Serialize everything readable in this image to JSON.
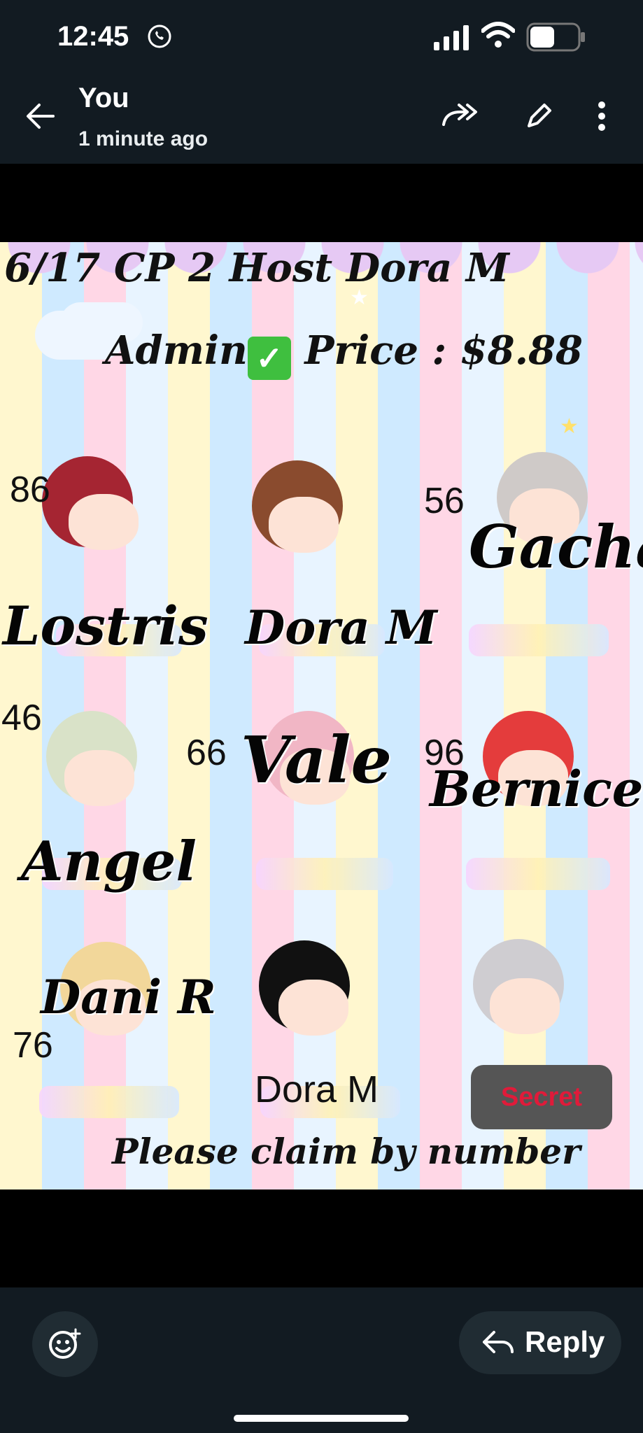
{
  "status_bar": {
    "time": "12:45"
  },
  "app_bar": {
    "title": "You",
    "subtitle": "1 minute ago"
  },
  "image": {
    "header_line": "6/17 CP 2 Host Dora M",
    "admin_label": "Admin",
    "price_label": "Price : $8.88",
    "items": [
      {
        "number": "86",
        "name": "Lostris"
      },
      {
        "number": "",
        "name": "Dora M"
      },
      {
        "number": "56",
        "name": "Gacha"
      },
      {
        "number": "46",
        "name": "Angel"
      },
      {
        "number": "66",
        "name": "Vale"
      },
      {
        "number": "96",
        "name": "Bernice"
      },
      {
        "number": "76",
        "name": "Dani R"
      },
      {
        "number": "",
        "name": "Dora M"
      },
      {
        "number": "",
        "name": "Secret"
      }
    ],
    "footer": "Please claim by number"
  },
  "actions": {
    "reply_label": "Reply"
  },
  "icons": [
    "whatsapp-icon",
    "signal-icon",
    "wifi-icon",
    "battery-icon",
    "back-arrow-icon",
    "forward-icon",
    "edit-pencil-icon",
    "more-vertical-icon",
    "emoji-add-icon",
    "reply-arrow-icon"
  ]
}
